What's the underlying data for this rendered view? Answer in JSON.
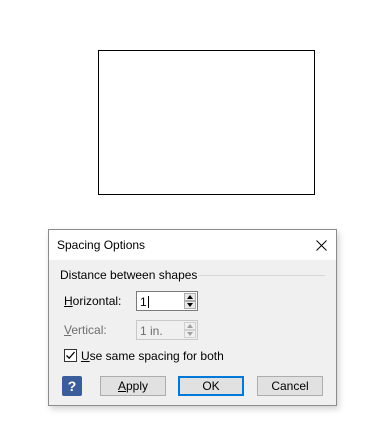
{
  "dialog": {
    "title": "Spacing Options",
    "group_label": "Distance between shapes",
    "horizontal": {
      "label_accel": "H",
      "label_rest": "orizontal:",
      "value": "1"
    },
    "vertical": {
      "label_accel": "V",
      "label_rest": "ertical:",
      "value": "1 in."
    },
    "same_spacing": {
      "label_accel": "U",
      "label_rest": "se same spacing for both",
      "checked": true
    },
    "buttons": {
      "help": "?",
      "apply_accel": "A",
      "apply_rest": "pply",
      "ok": "OK",
      "cancel": "Cancel"
    }
  },
  "colors": {
    "help_icon_bg": "#3c5d9c",
    "default_button_border": "#0078d7",
    "dialog_bg": "#f0f0f0"
  }
}
